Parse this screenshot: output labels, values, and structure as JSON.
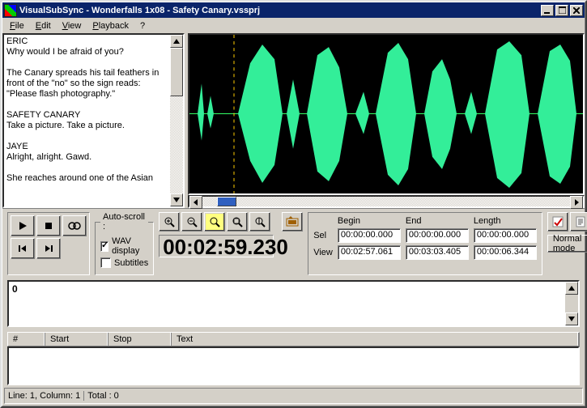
{
  "title": "VisualSubSync - Wonderfalls 1x08 - Safety Canary.vssprj",
  "menu": {
    "file": "File",
    "edit": "Edit",
    "view": "View",
    "playback": "Playback",
    "help": "?"
  },
  "script": "ERIC\nWhy would I be afraid of you?\n\nThe Canary spreads his tail feathers in front of the \"no\" so the sign reads: \"Please flash photography.\"\n\nSAFETY CANARY\nTake a picture. Take a picture.\n\nJAYE\nAlright, alright. Gawd.\n\nShe reaches around one of the Asian",
  "autoscroll": {
    "legend": "Auto-scroll :",
    "wav": "WAV display",
    "subs": "Subtitles"
  },
  "timecode": "00:02:59.230",
  "labels": {
    "begin": "Begin",
    "end": "End",
    "length": "Length",
    "sel": "Sel",
    "view": "View",
    "mode": "Normal mode"
  },
  "sel": {
    "begin": "00:00:00.000",
    "end": "00:00:00.000",
    "length": "00:00:00.000"
  },
  "view": {
    "begin": "00:02:57.061",
    "end": "00:03:03.405",
    "length": "00:00:06.344"
  },
  "mid": {
    "value": "0"
  },
  "grid": {
    "num": "#",
    "start": "Start",
    "stop": "Stop",
    "text": "Text"
  },
  "status": {
    "line": "Line: 1, Column: 1",
    "total": "Total : 0"
  }
}
